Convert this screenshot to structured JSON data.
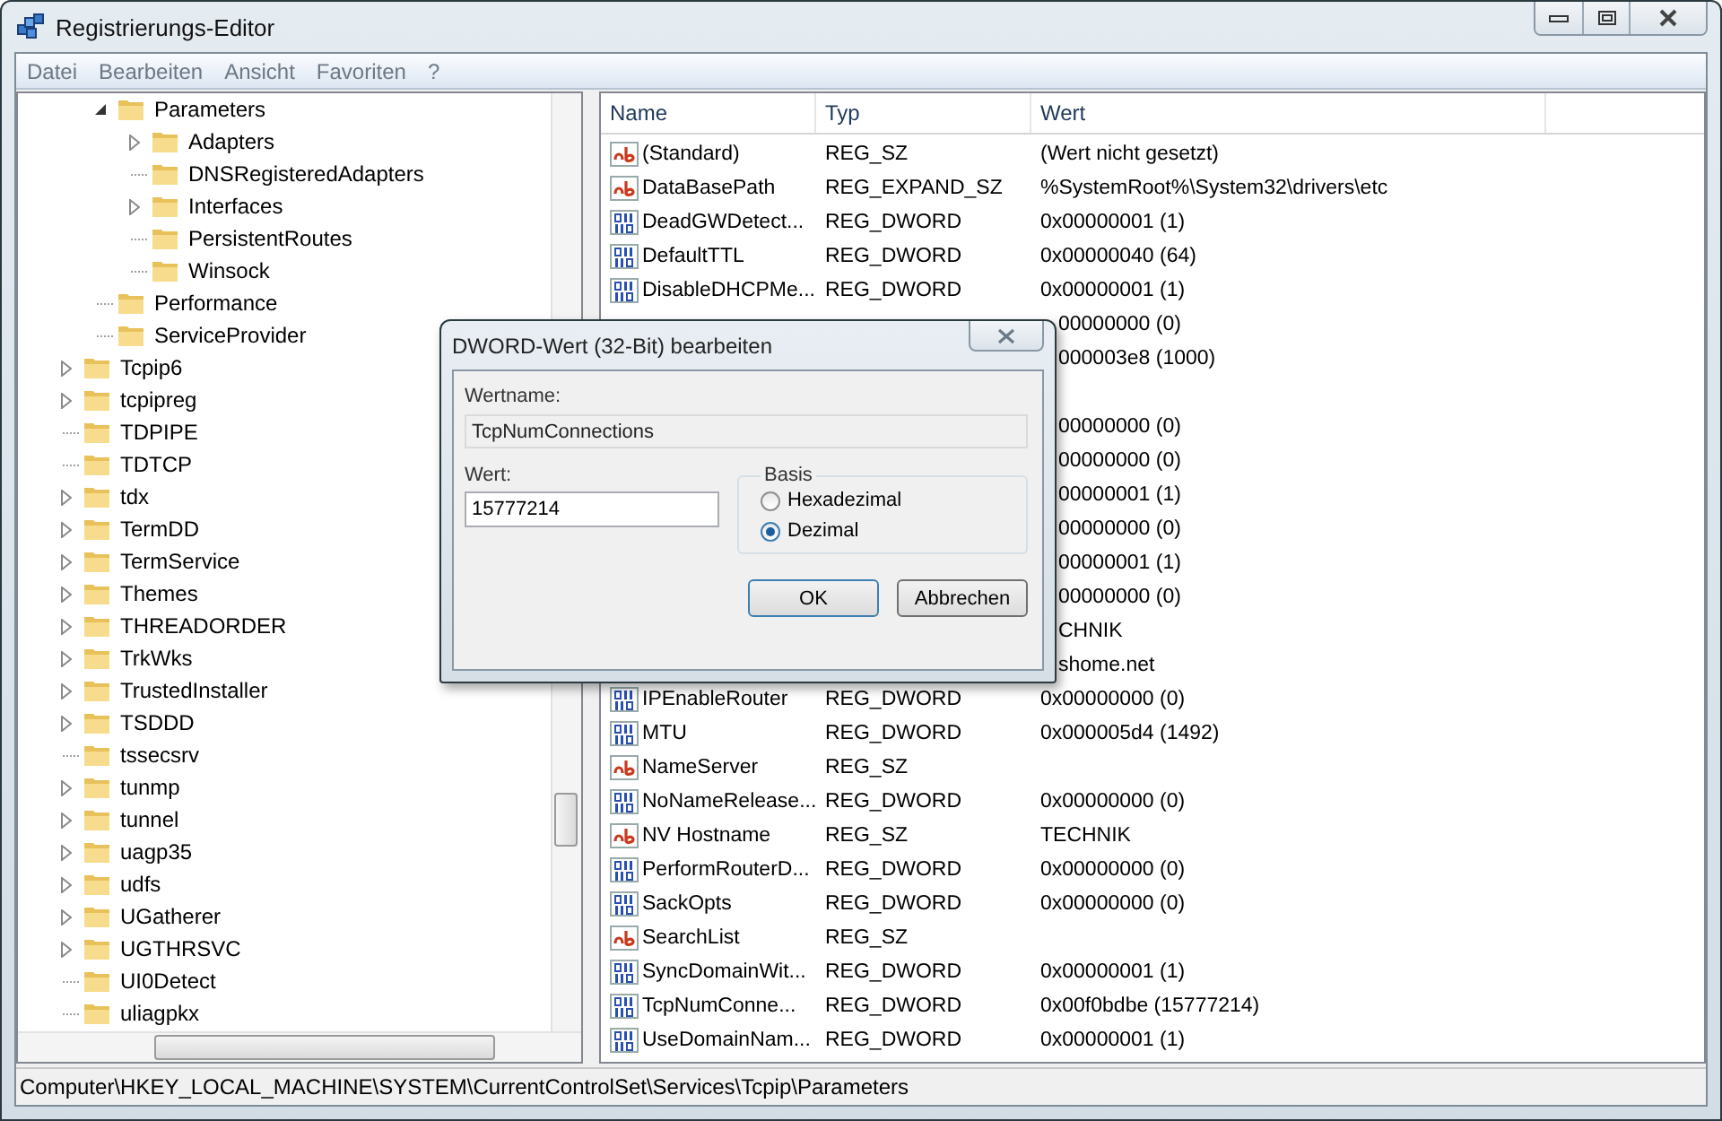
{
  "window": {
    "title": "Registrierungs-Editor"
  },
  "menu": [
    "Datei",
    "Bearbeiten",
    "Ansicht",
    "Favoriten",
    "?"
  ],
  "tree": {
    "items": [
      {
        "children": [
          {
            "label": "Parameters",
            "expanded": true,
            "children": [
              {
                "label": "Adapters",
                "expanded": false
              },
              {
                "label": "DNSRegisteredAdapters"
              },
              {
                "label": "Interfaces",
                "expanded": false
              },
              {
                "label": "PersistentRoutes"
              },
              {
                "label": "Winsock"
              }
            ]
          },
          {
            "label": "Performance"
          },
          {
            "label": "ServiceProvider"
          }
        ]
      },
      {
        "label": "Tcpip6",
        "expanded": false
      },
      {
        "label": "tcpipreg",
        "expanded": false
      },
      {
        "label": "TDPIPE"
      },
      {
        "label": "TDTCP"
      },
      {
        "label": "tdx",
        "expanded": false
      },
      {
        "label": "TermDD",
        "expanded": false
      },
      {
        "label": "TermService",
        "expanded": false
      },
      {
        "label": "Themes",
        "expanded": false
      },
      {
        "label": "THREADORDER",
        "expanded": false
      },
      {
        "label": "TrkWks",
        "expanded": false
      },
      {
        "label": "TrustedInstaller",
        "expanded": false
      },
      {
        "label": "TSDDD",
        "expanded": false
      },
      {
        "label": "tssecsrv"
      },
      {
        "label": "tunmp",
        "expanded": false
      },
      {
        "label": "tunnel",
        "expanded": false
      },
      {
        "label": "uagp35",
        "expanded": false
      },
      {
        "label": "udfs",
        "expanded": false
      },
      {
        "label": "UGatherer",
        "expanded": false
      },
      {
        "label": "UGTHRSVC",
        "expanded": false
      },
      {
        "label": "UI0Detect"
      },
      {
        "label": "uliagpkx"
      }
    ]
  },
  "table": {
    "columns": [
      "Name",
      "Typ",
      "Wert"
    ],
    "rows": [
      {
        "kind": "string",
        "name": "(Standard)",
        "type": "REG_SZ",
        "value": "(Wert nicht gesetzt)"
      },
      {
        "kind": "string",
        "name": "DataBasePath",
        "type": "REG_EXPAND_SZ",
        "value": "%SystemRoot%\\System32\\drivers\\etc"
      },
      {
        "kind": "number",
        "name": "DeadGWDetect...",
        "type": "REG_DWORD",
        "value": "0x00000001 (1)"
      },
      {
        "kind": "number",
        "name": "DefaultTTL",
        "type": "REG_DWORD",
        "value": "0x00000040 (64)"
      },
      {
        "kind": "number",
        "name": "DisableDHCPMe...",
        "type": "REG_DWORD",
        "value": "0x00000001 (1)"
      },
      {
        "kind": "covered",
        "value": "00000000 (0)"
      },
      {
        "kind": "covered",
        "value": "000003e8 (1000)"
      },
      {
        "kind": "covered"
      },
      {
        "kind": "covered",
        "value": "00000000 (0)"
      },
      {
        "kind": "covered",
        "value": "00000000 (0)"
      },
      {
        "kind": "covered",
        "value": "00000001 (1)"
      },
      {
        "kind": "covered",
        "value": "00000000 (0)"
      },
      {
        "kind": "covered",
        "value": "00000001 (1)"
      },
      {
        "kind": "covered",
        "value": "00000000 (0)"
      },
      {
        "kind": "covered",
        "value": "CHNIK"
      },
      {
        "kind": "covered",
        "value": "shome.net"
      },
      {
        "kind": "number",
        "name": "IPEnableRouter",
        "type": "REG_DWORD",
        "value": "0x00000000 (0)"
      },
      {
        "kind": "number",
        "name": "MTU",
        "type": "REG_DWORD",
        "value": "0x000005d4 (1492)"
      },
      {
        "kind": "string",
        "name": "NameServer",
        "type": "REG_SZ"
      },
      {
        "kind": "number",
        "name": "NoNameRelease...",
        "type": "REG_DWORD",
        "value": "0x00000000 (0)"
      },
      {
        "kind": "string",
        "name": "NV Hostname",
        "type": "REG_SZ",
        "value": "TECHNIK"
      },
      {
        "kind": "number",
        "name": "PerformRouterD...",
        "type": "REG_DWORD",
        "value": "0x00000000 (0)"
      },
      {
        "kind": "number",
        "name": "SackOpts",
        "type": "REG_DWORD",
        "value": "0x00000000 (0)"
      },
      {
        "kind": "string",
        "name": "SearchList",
        "type": "REG_SZ"
      },
      {
        "kind": "number",
        "name": "SyncDomainWit...",
        "type": "REG_DWORD",
        "value": "0x00000001 (1)"
      },
      {
        "kind": "number",
        "name": "TcpNumConne...",
        "type": "REG_DWORD",
        "value": "0x00f0bdbe (15777214)"
      },
      {
        "kind": "number",
        "name": "UseDomainNam...",
        "type": "REG_DWORD",
        "value": "0x00000001 (1)"
      }
    ]
  },
  "dialog": {
    "title": "DWORD-Wert (32-Bit) bearbeiten",
    "name_label": "Wertname:",
    "name_value": "TcpNumConnections",
    "value_label": "Wert:",
    "value": "15777214",
    "base_label": "Basis",
    "bases": [
      {
        "label": "Hexadezimal",
        "selected": false
      },
      {
        "label": "Dezimal",
        "selected": true
      }
    ],
    "buttons": [
      "OK",
      "Abbrechen"
    ]
  },
  "status_bar": "Computer\\HKEY_LOCAL_MACHINE\\SYSTEM\\CurrentControlSet\\Services\\Tcpip\\Parameters"
}
